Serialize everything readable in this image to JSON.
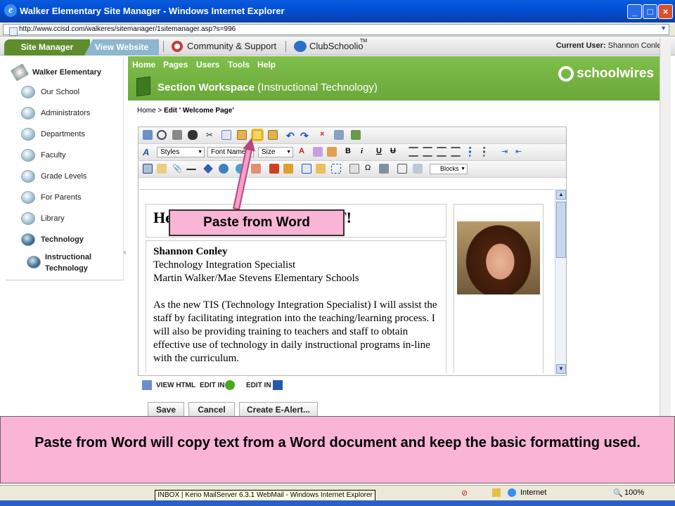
{
  "window": {
    "title": "Walker Elementary Site Manager - Windows Internet Explorer"
  },
  "address": {
    "url": "http://www.ccisd.com/walkeres/sitemanager/1sitemanager.asp?s=996"
  },
  "topnav": {
    "tab_site_manager": "Site Manager",
    "tab_view_website": "View Website",
    "community": "Community & Support",
    "clubschoolio": "ClubSchoolio",
    "tm": "TM",
    "current_user_label": "Current User:",
    "current_user": "Shannon Conley"
  },
  "sidebar": {
    "root": "Walker Elementary",
    "items": [
      "Our School",
      "Administrators",
      "Departments",
      "Faculty",
      "Grade Levels",
      "For Parents",
      "Library",
      "Technology"
    ],
    "sub_item_line1": "Instructional",
    "sub_item_line2": "Technology"
  },
  "header": {
    "nav": [
      "Home",
      "Pages",
      "Users",
      "Tools",
      "Help"
    ],
    "section_title": "Section Workspace",
    "section_sub": "(Instructional Technology)",
    "logo": "schoolwires"
  },
  "breadcrumb": {
    "home": "Home",
    "sep": ">",
    "current": "Edit ' Welcome Page'"
  },
  "toolbar": {
    "styles": "Styles",
    "font_name": "Font Name",
    "size": "Size",
    "blocks": "Blocks",
    "bold": "B",
    "italic": "i",
    "underline": "U",
    "strike": "U"
  },
  "document": {
    "heading_start": "He",
    "heading_end": "T!",
    "name": "Shannon Conley",
    "line2": "Technology Integration Specialist",
    "line3": "Martin Walker/Mae Stevens Elementary Schools",
    "paragraph": "As the new TIS (Technology Integration Specialist) I will assist the staff by facilitating integration into the teaching/learning process. I will also be providing training to teachers and staff to obtain effective use of technology in daily instructional programs in-line with the curriculum."
  },
  "editor_tabs": [
    "VIEW HTML",
    "EDIT IN",
    "EDIT IN"
  ],
  "actions": {
    "save": "Save",
    "cancel": "Cancel",
    "alert": "Create E-Alert..."
  },
  "annotation": {
    "callout": "Paste from Word",
    "caption": "Paste from Word will copy text from a Word document and keep the basic formatting used."
  },
  "status": {
    "zone": "Internet",
    "zoom": "100%",
    "tooltip": "INBOX | Kerio MailServer 6.3.1 WebMail - Windows Internet Explorer"
  },
  "colors": {
    "header_green": "#6aa83a",
    "callout_pink": "#f9b4d6",
    "xp_blue": "#0050d8"
  }
}
